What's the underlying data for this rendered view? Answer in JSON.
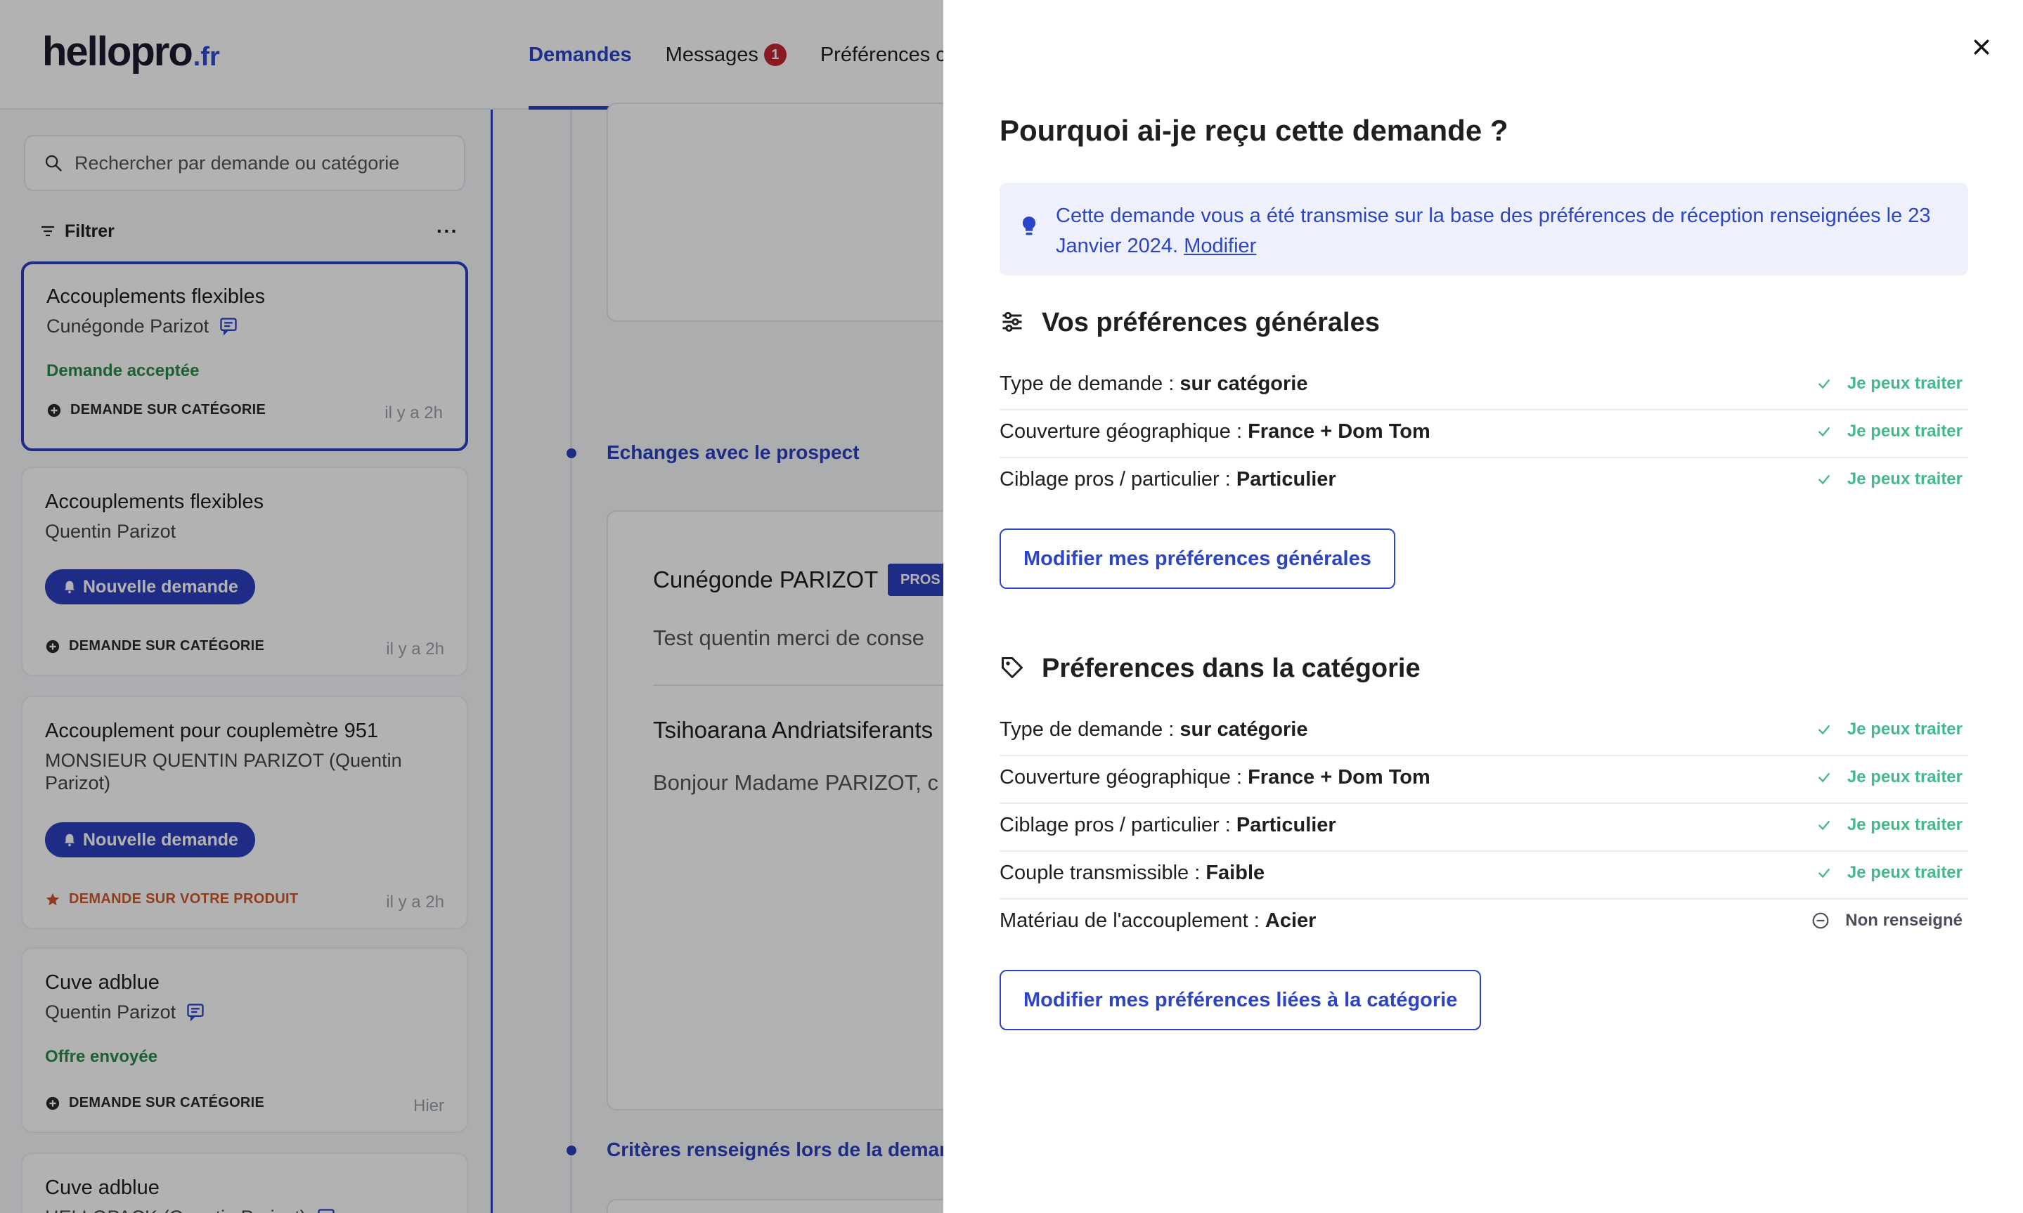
{
  "app": {
    "logo_main": "hellopro",
    "logo_fr": ".fr"
  },
  "nav": {
    "tabs": [
      {
        "label": "Demandes"
      },
      {
        "label": "Messages",
        "badge": "1"
      },
      {
        "label": "Préférences c"
      }
    ]
  },
  "sidebar": {
    "search_placeholder": "Rechercher par demande ou catégorie",
    "filter_label": "Filtrer",
    "more_label": "···",
    "cards": [
      {
        "title": "Accouplements flexibles",
        "subtitle": "Cunégonde Parizot",
        "status": "Demande acceptée",
        "tag": "DEMANDE SUR CATÉGORIE",
        "time": "il y a 2h"
      },
      {
        "title": "Accouplements flexibles",
        "subtitle": "Quentin Parizot",
        "pill": "Nouvelle demande",
        "tag": "DEMANDE SUR CATÉGORIE",
        "time": "il y a 2h"
      },
      {
        "title": "Accouplement pour couplemètre 951",
        "subtitle": "MONSIEUR QUENTIN PARIZOT (Quentin Parizot)",
        "pill": "Nouvelle demande",
        "tag": "DEMANDE SUR VOTRE PRODUIT",
        "time": "il y a 2h"
      },
      {
        "title": "Cuve adblue",
        "subtitle": "Quentin Parizot",
        "status": "Offre envoyée",
        "tag": "DEMANDE SUR CATÉGORIE",
        "time": "Hier"
      },
      {
        "title": "Cuve adblue",
        "subtitle": "HELLOPACK (Quentin Parizot)"
      }
    ]
  },
  "center": {
    "section1_label": "Echanges avec le prospect",
    "msg1_name": "Cunégonde PARIZOT",
    "msg1_badge": "PROS",
    "msg1_text": "Test quentin merci de conse",
    "msg2_name": "Tsihoarana Andriatsiferants",
    "msg2_text": "Bonjour Madame PARIZOT, c",
    "section2_label": "Critères renseignés lors de la deman"
  },
  "drawer": {
    "title": "Pourquoi ai-je reçu cette demande ?",
    "info_text": "Cette demande vous a été transmise sur la base des préférences de réception renseignées le 23 Janvier 2024.",
    "info_link": "Modifier",
    "general": {
      "title": "Vos préférences générales",
      "rows": [
        {
          "label": "Type de demande : ",
          "value": "sur catégorie",
          "status": "Je peux traiter"
        },
        {
          "label": "Couverture géographique : ",
          "value": "France + Dom Tom",
          "status": "Je peux traiter"
        },
        {
          "label": "Ciblage pros / particulier : ",
          "value": "Particulier",
          "status": "Je peux traiter"
        }
      ],
      "button": "Modifier mes préférences générales"
    },
    "category": {
      "title": "Préferences dans la catégorie",
      "rows": [
        {
          "label": "Type de demande : ",
          "value": "sur catégorie",
          "status": "Je peux traiter"
        },
        {
          "label": "Couverture géographique : ",
          "value": "France + Dom Tom",
          "status": "Je peux traiter"
        },
        {
          "label": "Ciblage pros / particulier : ",
          "value": "Particulier",
          "status": "Je peux traiter"
        },
        {
          "label": "Couple transmissible : ",
          "value": "Faible",
          "status": "Je peux traiter"
        },
        {
          "label": "Matériau de l'accouplement : ",
          "value": "Acier",
          "status": "Non renseigné"
        }
      ],
      "button": "Modifier mes préférences liées à la catégorie"
    }
  },
  "colors": {
    "brand_blue": "#2b44c8",
    "success_green": "#45b98b",
    "status_green": "#2c8a4e",
    "product_orange": "#d2552a",
    "badge_red": "#c42431"
  }
}
